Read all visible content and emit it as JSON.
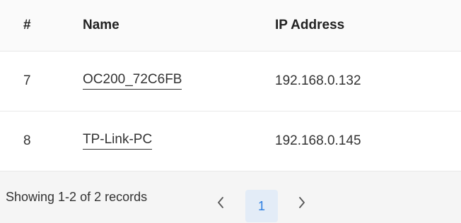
{
  "table": {
    "headers": {
      "number": "#",
      "name": "Name",
      "ip": "IP Address"
    },
    "rows": [
      {
        "number": "7",
        "name": "OC200_72C6FB",
        "ip": "192.168.0.132"
      },
      {
        "number": "8",
        "name": "TP-Link-PC",
        "ip": "192.168.0.145"
      }
    ]
  },
  "pagination": {
    "summary": "Showing 1-2 of 2 records",
    "current_page": "1",
    "prev_icon": "chevron-left-icon",
    "next_icon": "chevron-right-icon"
  },
  "colors": {
    "accent": "#2a7de1",
    "active_page_bg": "#e3ecf7",
    "footer_bg": "#f5f5f5",
    "header_bg": "#fafafa"
  }
}
